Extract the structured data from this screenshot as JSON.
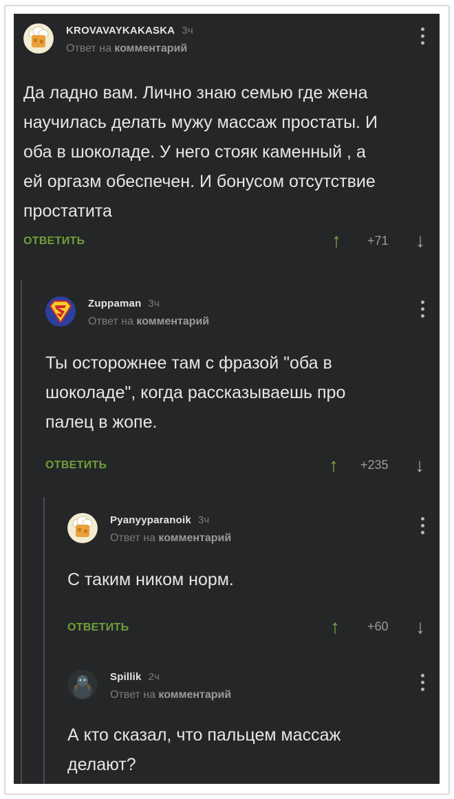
{
  "comments": [
    {
      "author": "KROVAVAYKAKASKA",
      "time": "3ч",
      "reply_prefix": "Ответ на",
      "reply_link": "комментарий",
      "text_lines": [
        "Да ладно вам. Лично знаю семью где жена",
        "научилась делать мужу массаж простаты. И",
        "оба в шоколаде. У него стояк каменный , а",
        "ей оргазм обеспечен. И бонусом отсутствие",
        "простатита"
      ],
      "reply_label": "ОТВЕТИТЬ",
      "rating": "+71",
      "avatar_icon": "chef-hat-avatar-icon"
    },
    {
      "author": "Zuppaman",
      "time": "3ч",
      "reply_prefix": "Ответ на",
      "reply_link": "комментарий",
      "text_lines": [
        "Ты осторожнее там с фразой \"оба в",
        "шоколаде\", когда рассказываешь про",
        "палец в жопе."
      ],
      "reply_label": "ОТВЕТИТЬ",
      "rating": "+235",
      "avatar_icon": "superman-logo-avatar-icon"
    },
    {
      "author": "Pyanyyparanoik",
      "time": "3ч",
      "reply_prefix": "Ответ на",
      "reply_link": "комментарий",
      "text_lines": [
        "С таким ником норм."
      ],
      "reply_label": "ОТВЕТИТЬ",
      "rating": "+60",
      "avatar_icon": "chef-hat-avatar-icon"
    },
    {
      "author": "Spillik",
      "time": "2ч",
      "reply_prefix": "Ответ на",
      "reply_link": "комментарий",
      "text_lines": [
        "А кто сказал, что пальцем массаж",
        "делают?"
      ],
      "avatar_icon": "dark-character-avatar-icon"
    }
  ],
  "icons": {
    "upvote": "↑",
    "downvote": "↓",
    "menu": "vertical-dots-icon"
  },
  "colors": {
    "background": "#252628",
    "text": "#e6e6e6",
    "reply_green": "#6f9f3a",
    "upvote_green": "#7fb044",
    "muted": "#7c7c7c"
  }
}
